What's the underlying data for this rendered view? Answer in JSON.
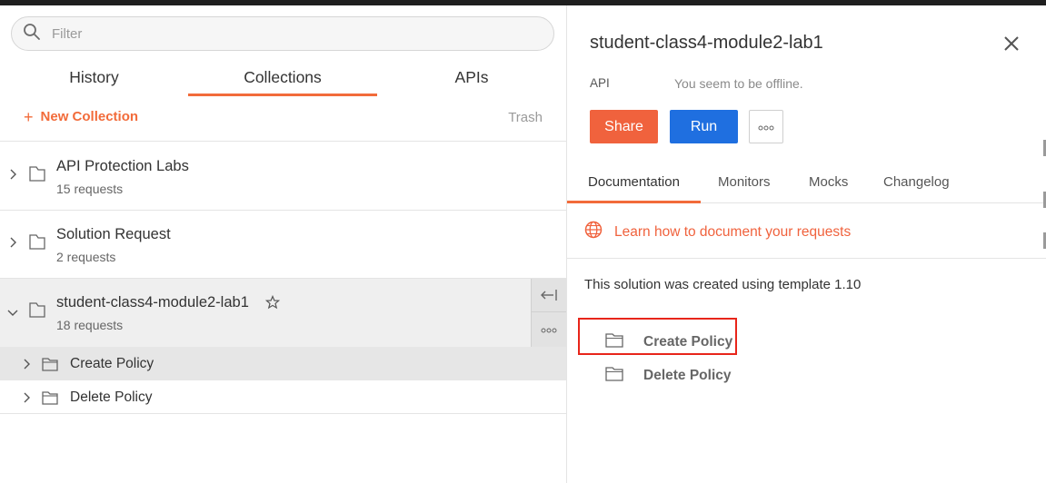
{
  "sidebar": {
    "filter_placeholder": "Filter",
    "tabs": [
      {
        "label": "History"
      },
      {
        "label": "Collections"
      },
      {
        "label": "APIs"
      }
    ],
    "new_collection_label": "New Collection",
    "trash_label": "Trash",
    "collections": [
      {
        "name": "API Protection Labs",
        "count": "15 requests"
      },
      {
        "name": "Solution Request",
        "count": "2 requests"
      },
      {
        "name": "student-class4-module2-lab1",
        "count": "18 requests"
      }
    ],
    "folders": [
      {
        "name": "Create Policy"
      },
      {
        "name": "Delete Policy"
      }
    ]
  },
  "panel": {
    "title": "student-class4-module2-lab1",
    "type_label": "API",
    "status_text": "You seem to be offline.",
    "share_label": "Share",
    "run_label": "Run",
    "tabs": [
      {
        "label": "Documentation"
      },
      {
        "label": "Monitors"
      },
      {
        "label": "Mocks"
      },
      {
        "label": "Changelog"
      }
    ],
    "learn_link": "Learn how to document your requests",
    "description": "This solution was created using template 1.10",
    "folders": [
      {
        "name": "Create Policy"
      },
      {
        "name": "Delete Policy"
      }
    ]
  },
  "colors": {
    "accent": "#f26b3a",
    "share": "#f0623d",
    "run": "#1f6fe0",
    "highlight_box": "#e8251a"
  },
  "icons": [
    "search-icon",
    "plus-icon",
    "chevron-right-icon",
    "chevron-down-icon",
    "collection-icon",
    "folder-icon",
    "star-icon",
    "collapse-panel-icon",
    "more-icon",
    "close-icon",
    "globe-icon"
  ]
}
